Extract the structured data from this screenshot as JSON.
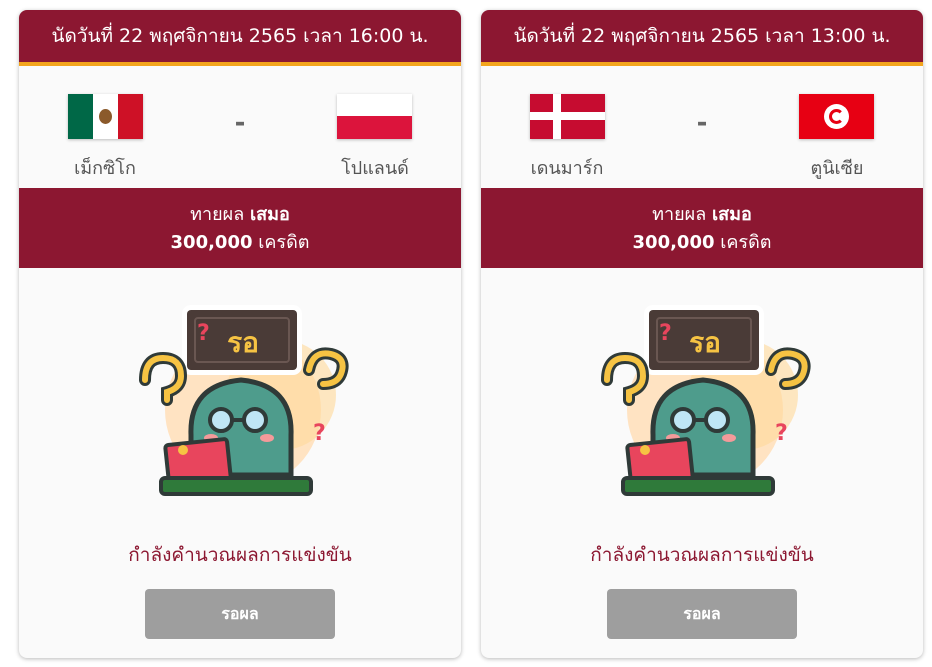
{
  "matches": [
    {
      "header": "นัดวันที่ 22 พฤศจิกายน 2565 เวลา 16:00 น.",
      "home": {
        "name": "เม็กซิโก",
        "flag": "mexico-flag"
      },
      "away": {
        "name": "โปแลนด์",
        "flag": "poland-flag"
      },
      "separator": "-",
      "prediction_label": "ทายผล",
      "prediction_value": "เสมอ",
      "credits_amount": "300,000",
      "credits_unit": "เครดิต",
      "mascot_sign": "รอ",
      "status_text": "กำลังคำนวณผลการแข่งขัน",
      "button_label": "รอผล"
    },
    {
      "header": "นัดวันที่ 22 พฤศจิกายน 2565 เวลา 13:00 น.",
      "home": {
        "name": "เดนมาร์ก",
        "flag": "denmark-flag"
      },
      "away": {
        "name": "ตูนิเซีย",
        "flag": "tunisia-flag"
      },
      "separator": "-",
      "prediction_label": "ทายผล",
      "prediction_value": "เสมอ",
      "credits_amount": "300,000",
      "credits_unit": "เครดิต",
      "mascot_sign": "รอ",
      "status_text": "กำลังคำนวณผลการแข่งขัน",
      "button_label": "รอผล"
    }
  ],
  "colors": {
    "primary": "#8c1731",
    "accent": "#f3a51d",
    "button_disabled": "#9e9e9e",
    "card_bg": "#fafafa"
  }
}
